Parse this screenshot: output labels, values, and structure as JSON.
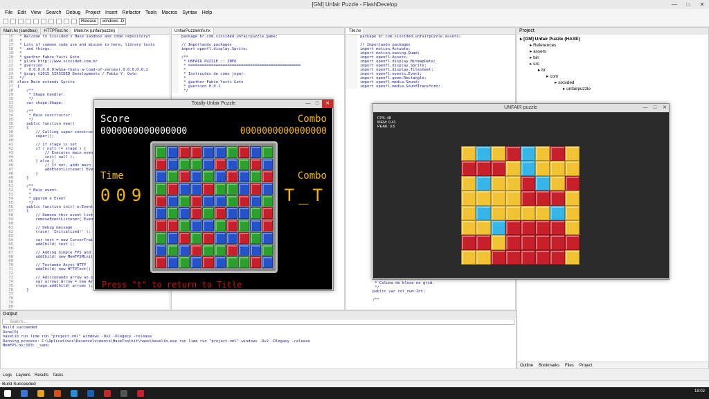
{
  "app": {
    "title": "[GM] Unfair Puzzle - FlashDevelop"
  },
  "menu": [
    "File",
    "Edit",
    "View",
    "Search",
    "Debug",
    "Project",
    "Insert",
    "Refactor",
    "Tools",
    "Macros",
    "Syntax",
    "Help"
  ],
  "toolbar": {
    "config": "Release",
    "target": "windows -D"
  },
  "editor1": {
    "tabs": [
      "Main.hx (sandbox)",
      "HTTPTest.hx",
      "Main.hx (unfairpuzzle)"
    ],
    "gutter": "15\n16\n17\n18\n19\n20\n21\n22\n23\n24\n25\n26\n27\n28\n29\n30\n31\n32\n33\n34\n35\n36\n37\n38\n39\n40\n41\n42\n43\n44\n45\n46\n47\n48\n49\n50\n51\n52\n53\n54\n55\n56\n57\n58\n59\n60\n61\n62\n63\n64\n65\n66\n67\n68\n69\n70\n71\n72\n73\n74\n75\n76\n77\n78\n79\n80\n81",
    "code": " * Welcome to Sixsided's Haxe sandbox and code repositoryt\n *\n * Lots of common code use and misuse in here, library tests\n *  and things.\n *\n * @author Fabio Yuiti Goto\n * @link http://www.sixsided.com.br\n * @version\n *   0.0.0.0.0.0(whoa-thats-a-load-of-zeroes).0.0.0.0.0.1\n * @copy ©2015 SIXSIDED Developments / Fabio Y. Goto\n */\nclass Main extends Sprite\n{\n    /**\n     * Shape handler.\n     */\n    var shape:Shape;\n\n    /**\n     * Main constructor.\n     */\n    public function new()\n    {\n        // Calling super constructor\n        super();\n\n        // If stage is set\n        if ( null != stage ) {\n            // Executes main event\n            init( null );\n        } else {\n            // If not, adds main\n            addEventListener( Event.\n        }\n    }\n\n    /**\n     * Main event.\n     *\n     * @param e Event\n     */\n    public function init( e:Event\n    {\n        // Remove this event list\n        removeEventListener( Event\n\n        // Debug message\n        trace( 'Initialized!' );\n\n        var test = new CursorTrail\n        addChild( test );\n\n        // Adding Simple FPS and\n        addChild( new MemFPSMini(\n\n        // Testando Async HTTP\n        addChild( new HTTPTest()\n\n        // Adicionando arrow ao stage\n        var arrows:Arrow = new Arrow();\n        stage.addChild( arrows );\n    }"
  },
  "editor2": {
    "tabs": [
      "UnfairPuzzleInfo.hx"
    ],
    "code": "package br.com.sixsided.unfairpuzzle.game;\n\n// Importando packages\nimport openfl.display.Sprite;\n\n/**\n * UNFAIR PUZZLE :: INFO\n * =================================================\n *\n * Instruções de como jogar.\n *\n * @author Fabio Yuiti Goto\n * @version 0.0.1\n */"
  },
  "editor3": {
    "tabs": [
      "Tile.hx"
    ],
    "code": "package br.com.sixsided.unfairpuzzle.assets;\n\n// Importando packages\nimport motion.Actuate;\nimport motion.easing.Quad;\nimport openfl.Assets;\nimport openfl.display.BitmapData;\nimport openfl.display.Sprite;\nimport openfl.display.Tilesheet;\nimport openfl.events.Event;\nimport openfl.geom.Rectangle;\nimport openfl.media.Sound;\nimport openfl.media.SoundTransform;",
    "code_tail": " * Coluna do bloco no grid.\n */\npublic var col_num:Int;\n\n/**"
  },
  "game1": {
    "title": "Totally Unfair Puzzle",
    "score_label": "Score",
    "score": "0000000000000000",
    "combo_label": "Combo",
    "combo": "0000000000000000",
    "time_label": "Time",
    "time": "009",
    "combo2_label": "Combo",
    "combo_face": "T_T",
    "prompt": "Press \"t\" to return to Title"
  },
  "game2": {
    "title": "UNFAIR puzzle",
    "fps": "FPS: 48\nMEM: 0.41\nPEAK: 0.6"
  },
  "project": {
    "title": "Project",
    "tree": [
      "[GM] Unfair Puzzle (HAXE)",
      "References",
      "assets",
      "bin",
      "src",
      "br",
      "com",
      "sixsided",
      "unfairpuzzle"
    ],
    "tabs": [
      "Outline",
      "Bookmarks",
      "Files",
      "Project"
    ]
  },
  "output": {
    "title": "Output",
    "search_placeholder": "Search...",
    "lines": "Build succeeded\nDone(0)\nhaxelib run lime run \"project.xml\" windows -Dv2 -Dlegacy -release\nRunning process: C:\\Aplicativos\\Desenvolvimento\\HaxeToolkit\\haxe\\haxelib.exe run lime run \"project.xml\" windows -Dv2 -Dlegacy -release\nMemFPS.hx:103: _sano"
  },
  "bottom_tabs": [
    "Logs",
    "Layouts",
    "Results",
    "Tasks"
  ],
  "status": "Build Succeeded",
  "clock": "19:02",
  "colors": {
    "red": "#c8202a",
    "green": "#2ca02c",
    "blue": "#2452c8",
    "yellow": "#f1c232",
    "cyan": "#35b5e8",
    "gold": "#f5b800"
  },
  "game1_grid": [
    "gbrrbbgrbg",
    "rbggbrbgrb",
    "bgrbgbrbgr",
    "grbbrggbrb",
    "rbgrbbgrbg",
    "bgbrgrbbgr",
    "rrgbbgrgbr",
    "gbrgrbbrgb",
    "bgbrggrbbg",
    "rbgbrbggrb"
  ],
  "game2_grid": [
    "ycyrcyry",
    "rrrycyyy",
    "ycyyrcyr",
    "yyyyrrry",
    "ycyyyycy",
    "yycrrrry",
    "rryrrrrr",
    "yyrrrrry"
  ]
}
